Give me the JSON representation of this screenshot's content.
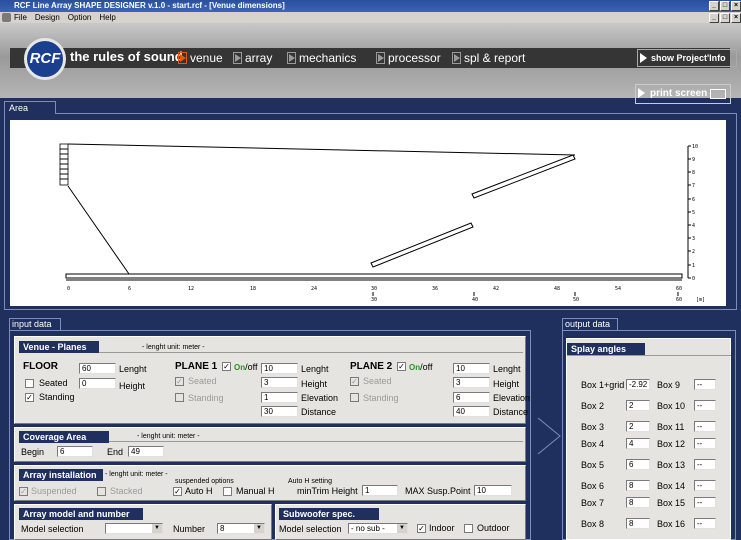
{
  "window": {
    "title": "RCF Line Array SHAPE DESIGNER v.1.0 - start.rcf - [Venue dimensions]",
    "controls": [
      "_",
      "□",
      "×"
    ],
    "mdi_controls": [
      "_",
      "□",
      "×"
    ]
  },
  "menu": {
    "items": [
      "File",
      "Design",
      "Option",
      "Help"
    ]
  },
  "nav": {
    "logo": "RCF",
    "tagline": "the rules of sound",
    "tabs": [
      "venue",
      "array",
      "mechanics",
      "processor",
      "spl & report"
    ],
    "active_tab": "venue",
    "project_info": "show Project'Info"
  },
  "area": {
    "tab": "Area",
    "print_label": "print screen",
    "x_ticks": [
      "0",
      "6",
      "12",
      "18",
      "24",
      "30",
      "36",
      "42",
      "48",
      "54",
      "60"
    ],
    "x_ticks_row2": [
      "30",
      "40",
      "50",
      "60"
    ],
    "unit": "[m]",
    "y_ticks": [
      "10",
      "9",
      "8",
      "7",
      "6",
      "5",
      "4",
      "3",
      "2",
      "1",
      "0"
    ]
  },
  "input": {
    "tab": "input data",
    "venue": {
      "header": "Venue - Planes",
      "unit_note": "- lenght unit: meter -",
      "floor": {
        "title": "FLOOR",
        "seated_label": "Seated",
        "standing_label": "Standing",
        "seated": false,
        "standing": true,
        "length_value": "60",
        "length_label": "Lenght",
        "height_value": "0",
        "height_label": "Height"
      },
      "plane1": {
        "title": "PLANE 1",
        "on_label": "On",
        "off_label": "/off",
        "seated_label": "Seated",
        "standing_label": "Standing",
        "values": [
          "10",
          "3",
          "1",
          "30"
        ],
        "labels": [
          "Lenght",
          "Height",
          "Elevation",
          "Distance"
        ]
      },
      "plane2": {
        "title": "PLANE 2",
        "on_label": "On",
        "off_label": "/off",
        "seated_label": "Seated",
        "standing_label": "Standing",
        "values": [
          "10",
          "3",
          "6",
          "40"
        ],
        "labels": [
          "Lenght",
          "Height",
          "Elevation",
          "Distance"
        ]
      }
    },
    "coverage": {
      "header": "Coverage Area",
      "unit_note": "- lenght unit: meter -",
      "begin_label": "Begin",
      "begin_value": "6",
      "end_label": "End",
      "end_value": "49"
    },
    "array_install": {
      "header": "Array installation",
      "unit_note": "- lenght unit: meter -",
      "suspended_label": "Suspended",
      "stacked_label": "Stacked",
      "suspended_options_label": "suspended options",
      "auto_h_label": "Auto H",
      "manual_h_label": "Manual H",
      "auto_h_setting_label": "Auto H setting",
      "min_trim_label": "minTrim Height",
      "min_trim_value": "1",
      "max_susp_label": "MAX Susp.Point",
      "max_susp_value": "10"
    },
    "array_model": {
      "header": "Array model  and number",
      "model_label": "Model selection",
      "model_value": "",
      "number_label": "Number",
      "number_value": "8"
    },
    "subwoofer": {
      "header": "Subwoofer spec.",
      "model_label": "Model selection",
      "model_value": "- no sub -",
      "indoor_label": "Indoor",
      "outdoor_label": "Outdoor"
    }
  },
  "output": {
    "tab": "output data",
    "header": "Splay angles",
    "left": [
      {
        "label": "Box 1+grid",
        "value": "-2.92"
      },
      {
        "label": "Box 2",
        "value": "2"
      },
      {
        "label": "Box 3",
        "value": "2"
      },
      {
        "label": "Box 4",
        "value": "4"
      },
      {
        "label": "Box 5",
        "value": "6"
      },
      {
        "label": "Box 6",
        "value": "8"
      },
      {
        "label": "Box 7",
        "value": "8"
      },
      {
        "label": "Box 8",
        "value": "8"
      }
    ],
    "right": [
      {
        "label": "Box 9",
        "value": "--"
      },
      {
        "label": "Box 10",
        "value": "--"
      },
      {
        "label": "Box 11",
        "value": "--"
      },
      {
        "label": "Box 12",
        "value": "--"
      },
      {
        "label": "Box 13",
        "value": "--"
      },
      {
        "label": "Box 14",
        "value": "--"
      },
      {
        "label": "Box 15",
        "value": "--"
      },
      {
        "label": "Box 16",
        "value": "--"
      }
    ]
  },
  "colors": {
    "background": "#20305e",
    "panel": "#e6e4e0",
    "accent": "#e9580f",
    "on_green": "#1c9a1c"
  }
}
